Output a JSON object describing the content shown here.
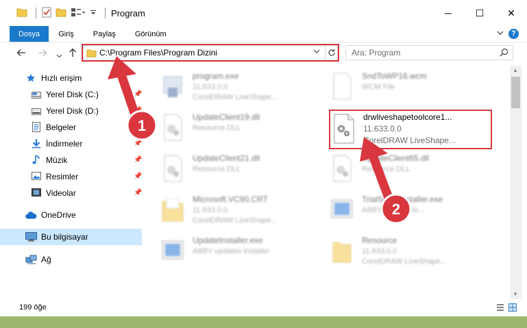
{
  "window": {
    "title": "Program",
    "minimize": "─",
    "maximize": "☐",
    "close": "✕"
  },
  "ribbon": {
    "tabs": [
      {
        "label": "Dosya"
      },
      {
        "label": "Giriş"
      },
      {
        "label": "Paylaş"
      },
      {
        "label": "Görünüm"
      }
    ],
    "help": "?"
  },
  "address": {
    "path": "C:\\Program Files\\Program Dizini"
  },
  "search": {
    "placeholder": "Ara: Program"
  },
  "sidebar": {
    "items": [
      {
        "label": "Hızlı erişim",
        "icon": "star-icon"
      },
      {
        "label": "Yerel Disk (C:)",
        "icon": "drive-icon",
        "pinned": true
      },
      {
        "label": "Yerel Disk (D:)",
        "icon": "drive-icon",
        "pinned": true
      },
      {
        "label": "Belgeler",
        "icon": "documents-icon",
        "pinned": true
      },
      {
        "label": "İndirmeler",
        "icon": "download-icon",
        "pinned": true
      },
      {
        "label": "Müzik",
        "icon": "music-icon",
        "pinned": true
      },
      {
        "label": "Resimler",
        "icon": "pictures-icon",
        "pinned": true
      },
      {
        "label": "Videolar",
        "icon": "videos-icon",
        "pinned": true
      },
      {
        "label": "OneDrive",
        "icon": "cloud-icon"
      },
      {
        "label": "Bu bilgisayar",
        "icon": "computer-icon",
        "selected": true
      },
      {
        "label": "Ağ",
        "icon": "network-icon"
      }
    ]
  },
  "files": [
    {
      "name": "program.exe",
      "sub1": "11.633.0.0",
      "sub2": "CorelDRAW LiveShape..."
    },
    {
      "name": "SndToWP16.wcm",
      "sub1": "WCM File",
      "sub2": ""
    },
    {
      "name": "UpdateClient19.dll",
      "sub1": "Resource DLL",
      "sub2": ""
    },
    {
      "name": "drwliveshapetoolcore1...",
      "sub1": "11.633.0.0",
      "sub2": "CorelDRAW LiveShape...",
      "highlighted": true
    },
    {
      "name": "UpdateClient21.dll",
      "sub1": "Resource DLL",
      "sub2": ""
    },
    {
      "name": "UpdateClient65.dll",
      "sub1": "Resource DLL",
      "sub2": ""
    },
    {
      "name": "Microsoft.VC90.CRT",
      "sub1": "11.633.0.0",
      "sub2": "CorelDRAW LiveShape..."
    },
    {
      "name": "TrialSetupInstaller.exe",
      "sub1": "ABBY updater to...",
      "sub2": ""
    },
    {
      "name": "UpdateInstaller.exe",
      "sub1": "ABBY updates installer",
      "sub2": ""
    },
    {
      "name": "Resource",
      "sub1": "11.633.0.0",
      "sub2": "CorelDRAW LiveShape..."
    }
  ],
  "status": {
    "count": "199 öğe"
  },
  "annotations": {
    "step1": "1",
    "step2": "2",
    "color": "#d9363e"
  }
}
